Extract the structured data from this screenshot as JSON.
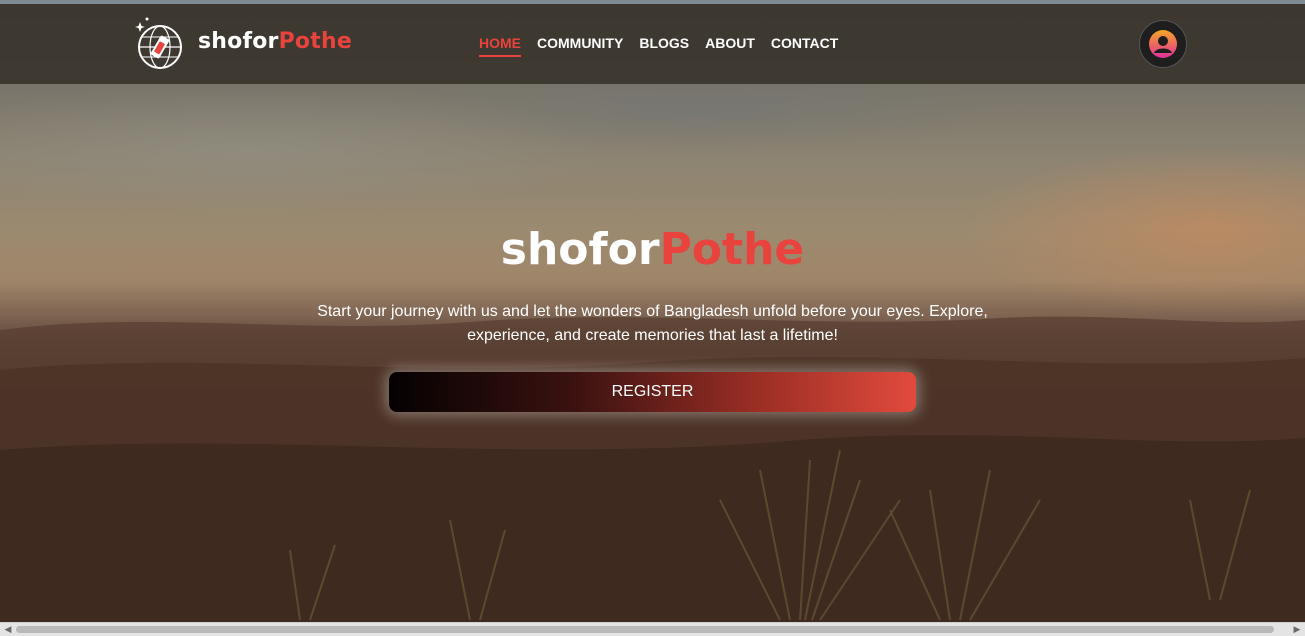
{
  "brand": {
    "name_part1": "shofor",
    "name_part2": "Pothe",
    "accent_color": "#e8433c"
  },
  "nav": {
    "items": [
      {
        "label": "HOME",
        "active": true
      },
      {
        "label": "COMMUNITY",
        "active": false
      },
      {
        "label": "BLOGS",
        "active": false
      },
      {
        "label": "ABOUT",
        "active": false
      },
      {
        "label": "CONTACT",
        "active": false
      }
    ]
  },
  "user": {
    "icon": "user-avatar-icon"
  },
  "hero": {
    "title_part1": "shofor",
    "title_part2": "Pothe",
    "description": "Start your journey with us and let the wonders of Bangladesh unfold before your eyes. Explore, experience, and create memories that last a lifetime!",
    "register_label": "REGISTER"
  },
  "scrollbar": {
    "left_arrow": "◀",
    "right_arrow": "▶"
  }
}
